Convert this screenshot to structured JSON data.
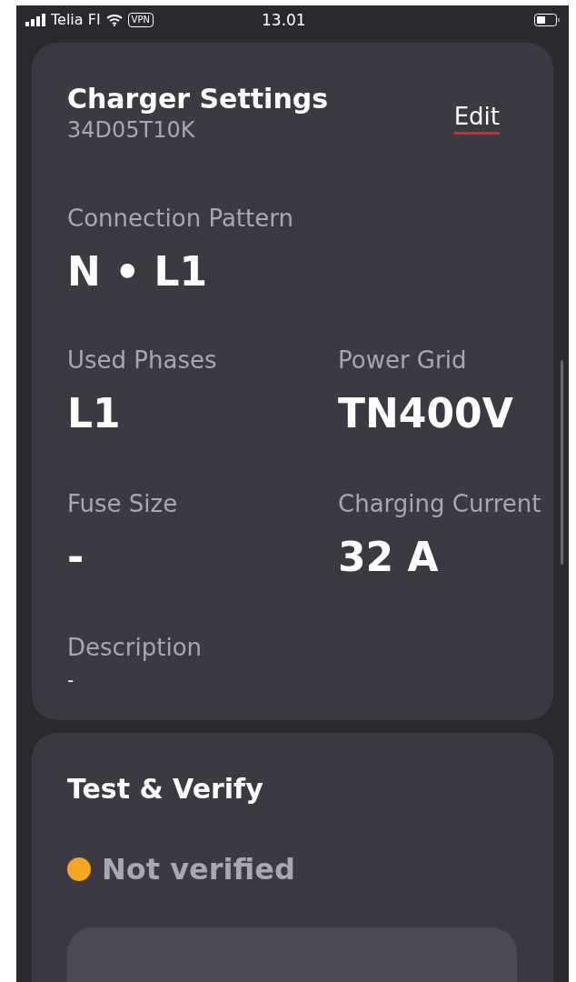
{
  "status_bar": {
    "carrier": "Telia FI",
    "vpn": "VPN",
    "time": "13.01"
  },
  "charger_settings": {
    "title": "Charger Settings",
    "serial": "34D05T10K",
    "edit": "Edit",
    "connection_pattern": {
      "label": "Connection Pattern",
      "value": "N • L1"
    },
    "fields": [
      {
        "label": "Used Phases",
        "value": "L1"
      },
      {
        "label": "Power Grid",
        "value": "TN400V"
      },
      {
        "label": "Fuse Size",
        "value": "-"
      },
      {
        "label": "Charging Current",
        "value": "32 A"
      }
    ],
    "description": {
      "label": "Description",
      "value": "-"
    }
  },
  "test_verify": {
    "title": "Test & Verify",
    "status": {
      "label": "Not verified",
      "color": "#f5a623"
    }
  }
}
